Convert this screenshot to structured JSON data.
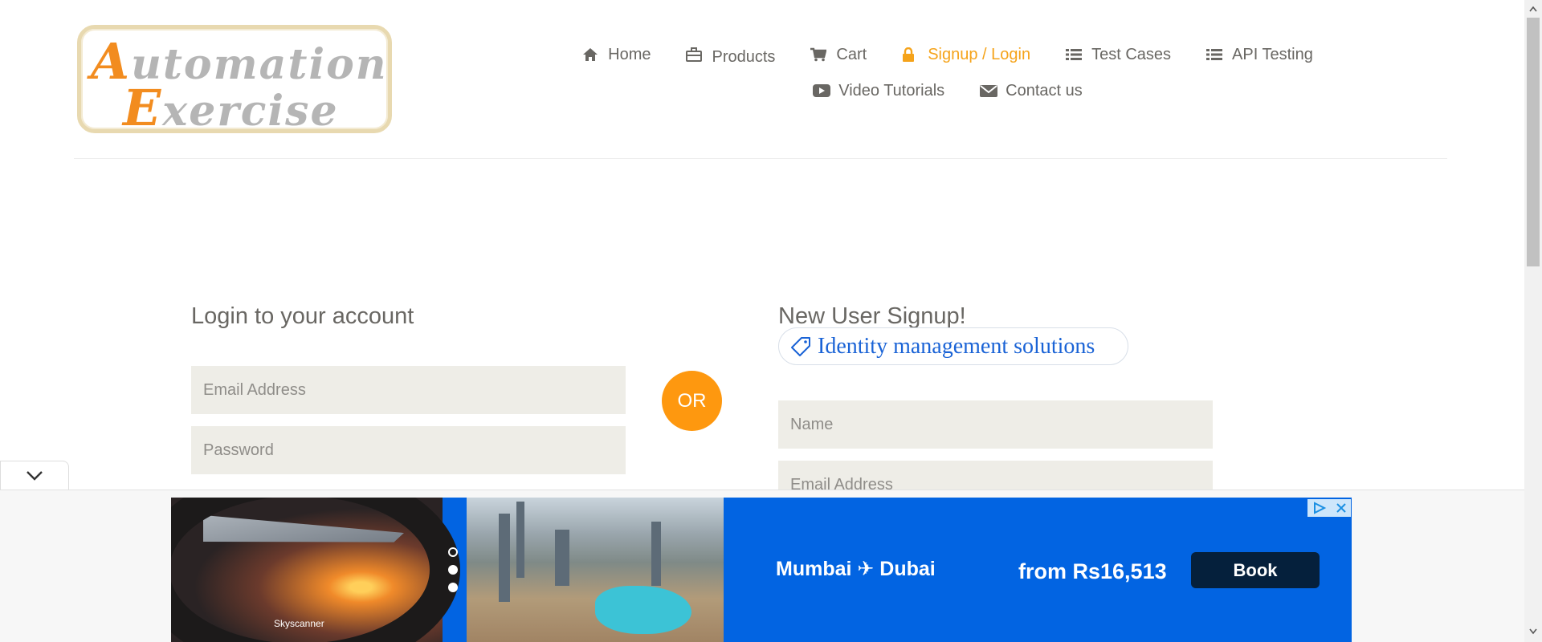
{
  "logo": {
    "line1_cap": "A",
    "line1_rest": "utomation",
    "line2_cap": "E",
    "line2_rest": "xercise"
  },
  "nav": [
    {
      "label": "Home",
      "icon": "home-icon"
    },
    {
      "label": "Products",
      "icon": "briefcase-icon"
    },
    {
      "label": "Cart",
      "icon": "cart-icon"
    },
    {
      "label": "Signup / Login",
      "icon": "lock-icon",
      "active": true
    },
    {
      "label": "Test Cases",
      "icon": "list-icon"
    },
    {
      "label": "API Testing",
      "icon": "list-icon"
    },
    {
      "label": "Video Tutorials",
      "icon": "youtube-play-icon"
    },
    {
      "label": "Contact us",
      "icon": "envelope-icon"
    }
  ],
  "login": {
    "title": "Login to your account",
    "email_placeholder": "Email Address",
    "password_placeholder": "Password"
  },
  "or_label": "OR",
  "signup": {
    "title": "New User Signup!",
    "name_placeholder": "Name",
    "email_placeholder": "Email Address"
  },
  "ad_chip": {
    "label": "Identity management solutions",
    "icon": "tag-icon"
  },
  "ad_banner": {
    "brand": "Skyscanner",
    "route": "Mumbai ✈ Dubai",
    "price": "from Rs16,513",
    "cta": "Book",
    "bg_color": "#0264e2",
    "cta_color": "#05203c"
  },
  "colors": {
    "accent": "#fe980f",
    "active_nav": "#f5a31a",
    "text": "#696763",
    "field_bg": "#eeede7"
  }
}
